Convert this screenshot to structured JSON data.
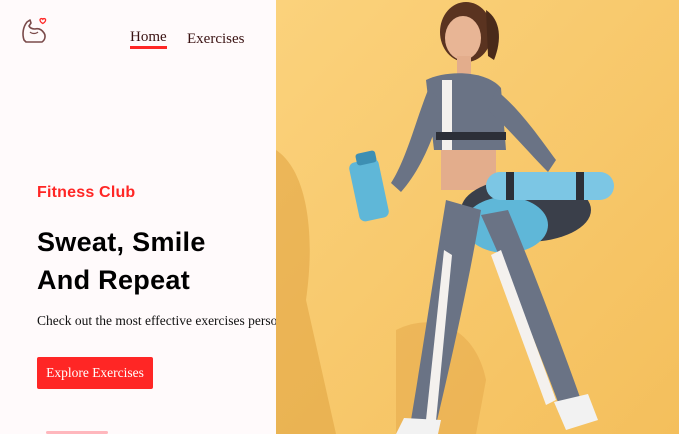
{
  "nav": {
    "logo_icon": "flexed-arm-heart-logo",
    "home_label": "Home",
    "exercises_label": "Exercises",
    "accent_color": "#ff2625"
  },
  "hero": {
    "brand": "Fitness Club",
    "headline_line1": "Sweat, Smile",
    "headline_line2": "And Repeat",
    "subtitle": "Check out the most effective exercises personalized to you",
    "cta_label": "Explore Exercises",
    "banner_image": "woman-walking-with-yoga-mat-and-water-bottle"
  }
}
